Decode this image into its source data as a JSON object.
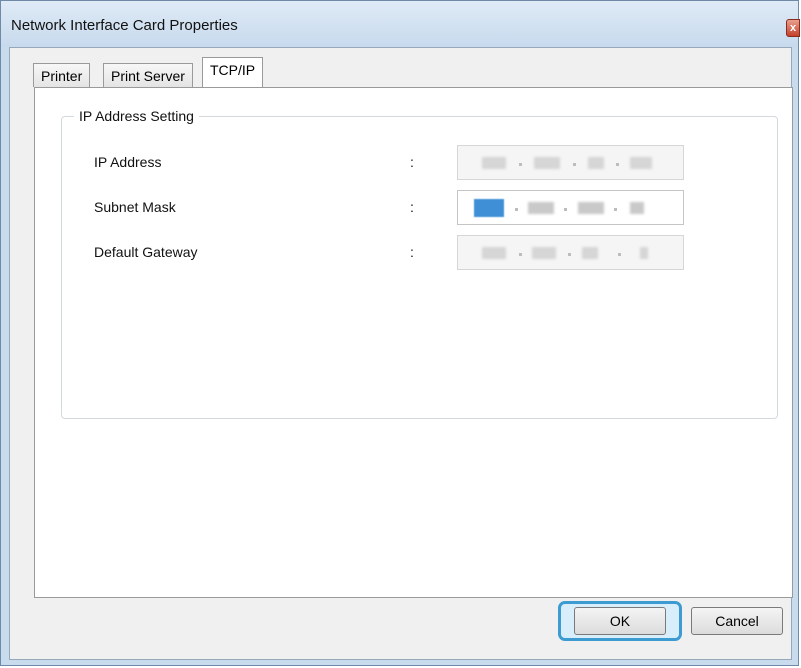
{
  "window": {
    "title": "Network Interface Card Properties",
    "close_label": "x"
  },
  "tabs": [
    {
      "label": "Printer",
      "active": false
    },
    {
      "label": "Print Server",
      "active": false
    },
    {
      "label": "TCP/IP",
      "active": true
    }
  ],
  "group": {
    "title": "IP Address Setting",
    "fields": [
      {
        "label": "IP Address",
        "colon": ":",
        "enabled": false,
        "value_visible": "obscured"
      },
      {
        "label": "Subnet Mask",
        "colon": ":",
        "enabled": true,
        "value_visible": "obscured"
      },
      {
        "label": "Default Gateway",
        "colon": ":",
        "enabled": false,
        "value_visible": "obscured"
      }
    ]
  },
  "buttons": {
    "ok_label": "OK",
    "cancel_label": "Cancel"
  },
  "colors": {
    "titlebar": "#c9dcee",
    "focus_ring": "#3c9bd1",
    "selection": "#3f8fd6"
  }
}
